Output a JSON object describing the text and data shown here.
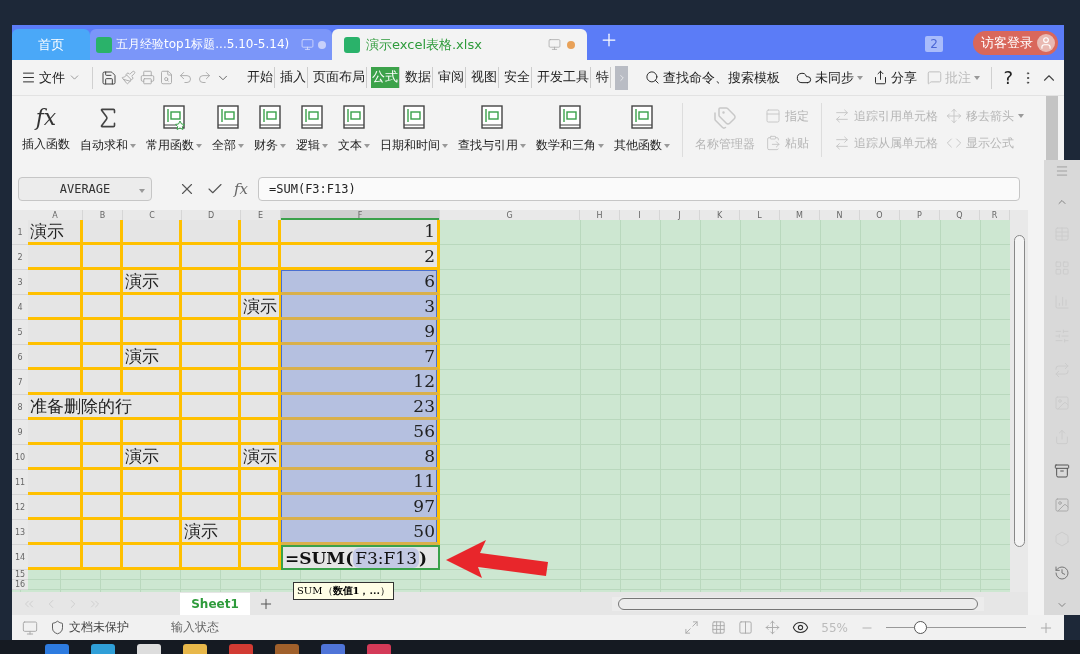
{
  "title_bar": {
    "tabs": [
      {
        "label": "首页",
        "kind": "home",
        "selected": false
      },
      {
        "label": "五月经验top1标题...5.10-5.14)",
        "kind": "doc",
        "selected": false,
        "unsaved": false
      },
      {
        "label": "演示excel表格.xlsx",
        "kind": "doc",
        "selected": true,
        "unsaved": true
      }
    ],
    "window_count": "2",
    "login": "访客登录"
  },
  "menu_bar": {
    "file": "文件",
    "tabs": [
      {
        "label": "开始",
        "selected": false
      },
      {
        "label": "插入",
        "selected": false
      },
      {
        "label": "页面布局",
        "selected": false
      },
      {
        "label": "公式",
        "selected": true
      },
      {
        "label": "数据",
        "selected": false
      },
      {
        "label": "审阅",
        "selected": false
      },
      {
        "label": "视图",
        "selected": false
      },
      {
        "label": "安全",
        "selected": false
      },
      {
        "label": "开发工具",
        "selected": false
      },
      {
        "label": "特",
        "selected": false
      }
    ],
    "search": "查找命令、搜索模板",
    "sync": "未同步",
    "share": "分享",
    "comment": {
      "label": "批注",
      "disabled": true
    },
    "help": "?"
  },
  "ribbon": {
    "functions": [
      {
        "label": "插入函数",
        "dropdown": false
      },
      {
        "label": "自动求和",
        "dropdown": true
      },
      {
        "label": "常用函数",
        "dropdown": true
      },
      {
        "label": "全部",
        "dropdown": true
      },
      {
        "label": "财务",
        "dropdown": true
      },
      {
        "label": "逻辑",
        "dropdown": true
      },
      {
        "label": "文本",
        "dropdown": true
      },
      {
        "label": "日期和时间",
        "dropdown": true
      },
      {
        "label": "查找与引用",
        "dropdown": true
      },
      {
        "label": "数学和三角",
        "dropdown": true
      },
      {
        "label": "其他函数",
        "dropdown": true
      }
    ],
    "icon_text": "fx",
    "name_manager": {
      "label": "名称管理器",
      "disabled": true
    },
    "name_tools": [
      {
        "label": "指定",
        "disabled": true
      },
      {
        "label": "粘贴",
        "disabled": true
      }
    ],
    "audit": [
      {
        "label": "追踪引用单元格",
        "disabled": true,
        "dropdown": false
      },
      {
        "label": "移去箭头",
        "disabled": true,
        "dropdown": true
      },
      {
        "label": "追踪从属单元格",
        "disabled": true,
        "dropdown": false
      },
      {
        "label": "显示公式",
        "disabled": true,
        "dropdown": false
      }
    ]
  },
  "formula_bar": {
    "name_box": "AVERAGE",
    "fx": "fx",
    "formula": "=SUM(F3:F13)"
  },
  "sheet": {
    "columns": [
      {
        "label": "A",
        "selected": false
      },
      {
        "label": "B",
        "selected": false
      },
      {
        "label": "C",
        "selected": false
      },
      {
        "label": "D",
        "selected": false
      },
      {
        "label": "E",
        "selected": false
      },
      {
        "label": "F",
        "selected": true
      },
      {
        "label": "G",
        "selected": false
      },
      {
        "label": "H",
        "selected": false
      },
      {
        "label": "I",
        "selected": false
      },
      {
        "label": "J",
        "selected": false
      },
      {
        "label": "K",
        "selected": false
      },
      {
        "label": "L",
        "selected": false
      },
      {
        "label": "M",
        "selected": false
      },
      {
        "label": "N",
        "selected": false
      },
      {
        "label": "O",
        "selected": false
      },
      {
        "label": "P",
        "selected": false
      },
      {
        "label": "Q",
        "selected": false
      },
      {
        "label": "R",
        "selected": false
      }
    ],
    "rows": [
      {
        "row": "1",
        "a": "演示",
        "f": "1",
        "selected": false
      },
      {
        "row": "2",
        "f": "2",
        "selected": false
      },
      {
        "row": "3",
        "c": "演示",
        "f": "6",
        "selected": true
      },
      {
        "row": "4",
        "e": "演示",
        "f": "3",
        "selected": true
      },
      {
        "row": "5",
        "f": "9",
        "selected": true
      },
      {
        "row": "6",
        "c": "演示",
        "f": "7",
        "selected": true
      },
      {
        "row": "7",
        "f": "12",
        "selected": true
      },
      {
        "row": "8",
        "a": "准备删除的行",
        "f": "23",
        "selected": true
      },
      {
        "row": "9",
        "f": "56",
        "selected": true
      },
      {
        "row": "10",
        "c": "演示",
        "e": "演示",
        "f": "8",
        "selected": true
      },
      {
        "row": "11",
        "f": "11",
        "selected": true
      },
      {
        "row": "12",
        "f": "97",
        "selected": true
      },
      {
        "row": "13",
        "d": "演示",
        "f": "50",
        "selected": true
      },
      {
        "row": "14",
        "selected": false,
        "editing": {
          "prefix": "=SUM(",
          "ref": "F3:F13",
          "suffix": ")"
        }
      }
    ],
    "extra_rows": [
      "15",
      "16"
    ],
    "tooltip": "SUM（**数值1，...**）"
  },
  "sheet_tabs": [
    {
      "label": "Sheet1",
      "selected": true
    }
  ],
  "status_bar": {
    "protect": "文档未保护",
    "mode": "输入状态",
    "zoom": "55%",
    "zoom_slider": {
      "level": 0.24
    }
  }
}
